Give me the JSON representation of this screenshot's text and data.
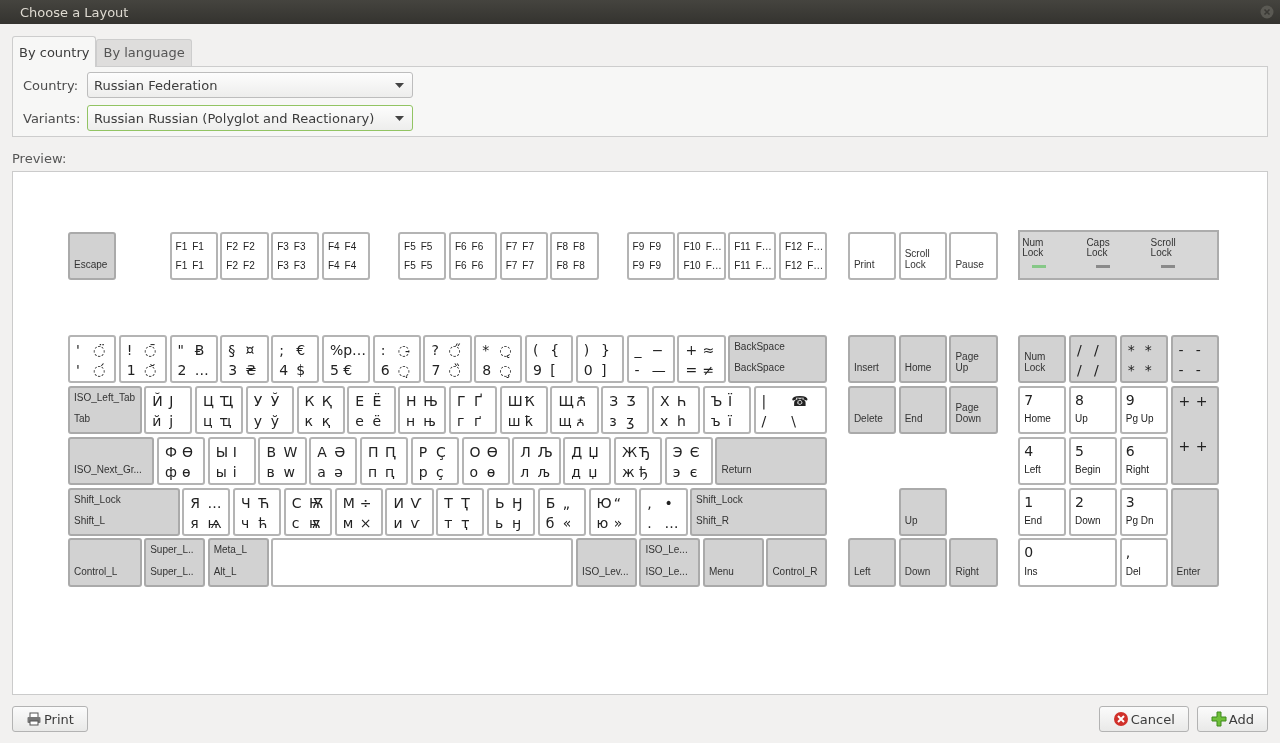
{
  "window": {
    "title": "Choose a Layout"
  },
  "tabs": [
    {
      "label": "By country",
      "selected": true
    },
    {
      "label": "By language",
      "selected": false
    }
  ],
  "form": [
    {
      "label": "Country:",
      "value": "Russian Federation",
      "focused": false
    },
    {
      "label": "Variants:",
      "value": "Russian Russian (Polyglot and Reactionary)",
      "focused": true
    }
  ],
  "preview": {
    "label": "Preview:",
    "keyboard": {
      "function_row": [
        [
          {
            "kind": "mod",
            "legends": [
              "Escape"
            ]
          }
        ],
        [
          {
            "kind": "fn",
            "legends": [
              "F1",
              "F1",
              "F1",
              "F1"
            ]
          },
          {
            "kind": "fn",
            "legends": [
              "F2",
              "F2",
              "F2",
              "F2"
            ]
          },
          {
            "kind": "fn",
            "legends": [
              "F3",
              "F3",
              "F3",
              "F3"
            ]
          },
          {
            "kind": "fn",
            "legends": [
              "F4",
              "F4",
              "F4",
              "F4"
            ]
          }
        ],
        [
          {
            "kind": "fn",
            "legends": [
              "F5",
              "F5",
              "F5",
              "F5"
            ]
          },
          {
            "kind": "fn",
            "legends": [
              "F6",
              "F6",
              "F6",
              "F6"
            ]
          },
          {
            "kind": "fn",
            "legends": [
              "F7",
              "F7",
              "F7",
              "F7"
            ]
          },
          {
            "kind": "fn",
            "legends": [
              "F8",
              "F8",
              "F8",
              "F8"
            ]
          }
        ],
        [
          {
            "kind": "fn",
            "legends": [
              "F9",
              "F9",
              "F9",
              "F9"
            ]
          },
          {
            "kind": "fn",
            "legends": [
              "F10",
              "F…",
              "F10",
              "F…"
            ]
          },
          {
            "kind": "fn",
            "legends": [
              "F11",
              "F…",
              "F11",
              "F…"
            ]
          },
          {
            "kind": "fn",
            "legends": [
              "F12",
              "F…",
              "F12",
              "F…"
            ]
          }
        ]
      ],
      "system_keys": [
        {
          "kind": "sys",
          "legends": [
            "Print"
          ]
        },
        {
          "kind": "sys",
          "legends": [
            "Scroll Lock"
          ]
        },
        {
          "kind": "sys",
          "legends": [
            "Pause"
          ]
        }
      ],
      "indicators": [
        {
          "label": "Num Lock",
          "on": true
        },
        {
          "label": "Caps Lock",
          "on": false
        },
        {
          "label": "Scroll Lock",
          "on": false
        }
      ],
      "main_rows": [
        [
          {
            "kind": "char",
            "legends": [
              "'",
              "◌̈",
              "'",
              "◌́"
            ]
          },
          {
            "kind": "char",
            "legends": [
              "!",
              "◌̄",
              "1",
              "◌̆"
            ]
          },
          {
            "kind": "char",
            "legends": [
              "\"",
              "Ƀ",
              "2",
              "…"
            ]
          },
          {
            "kind": "char",
            "legends": [
              "§",
              "¤",
              "3",
              "₴"
            ]
          },
          {
            "kind": "char",
            "legends": [
              ";",
              "€",
              "4",
              "$"
            ]
          },
          {
            "kind": "char",
            "legends": [
              "%",
              "р…",
              "5",
              "€"
            ]
          },
          {
            "kind": "char",
            "legends": [
              ":",
              "◌̵",
              "6",
              "◌̣"
            ]
          },
          {
            "kind": "char",
            "legends": [
              "?",
              "◌̋",
              "7",
              "◌̏"
            ]
          },
          {
            "kind": "char",
            "legends": [
              "*",
              "◌̨",
              "8",
              "◌̧"
            ]
          },
          {
            "kind": "char",
            "legends": [
              "(",
              "{",
              "9",
              "["
            ]
          },
          {
            "kind": "char",
            "legends": [
              ")",
              "}",
              "0",
              "]"
            ]
          },
          {
            "kind": "char",
            "legends": [
              "_",
              "−",
              "-",
              "—"
            ]
          },
          {
            "kind": "char",
            "legends": [
              "+",
              "≈",
              "=",
              "≠"
            ]
          },
          {
            "kind": "mod",
            "legends": [
              "BackSpace",
              "BackSpace"
            ]
          }
        ],
        [
          {
            "kind": "mod",
            "legends": [
              "ISO_Left_Tab",
              "Tab"
            ]
          },
          {
            "kind": "char",
            "legends": [
              "Й",
              "Ј",
              "й",
              "ј"
            ]
          },
          {
            "kind": "char",
            "legends": [
              "Ц",
              "Ҵ",
              "ц",
              "ҵ"
            ]
          },
          {
            "kind": "char",
            "legends": [
              "У",
              "Ў",
              "у",
              "ў"
            ]
          },
          {
            "kind": "char",
            "legends": [
              "К",
              "Қ",
              "к",
              "қ"
            ]
          },
          {
            "kind": "char",
            "legends": [
              "Е",
              "Ё",
              "е",
              "ё"
            ]
          },
          {
            "kind": "char",
            "legends": [
              "Н",
              "Њ",
              "н",
              "њ"
            ]
          },
          {
            "kind": "char",
            "legends": [
              "Г",
              "Ґ",
              "г",
              "ґ"
            ]
          },
          {
            "kind": "char",
            "legends": [
              "Ш",
              "Ҟ",
              "ш",
              "ҟ"
            ]
          },
          {
            "kind": "char",
            "legends": [
              "Щ",
              "Ꙉ",
              "щ",
              "ꙉ"
            ]
          },
          {
            "kind": "char",
            "legends": [
              "З",
              "Ʒ",
              "з",
              "ʒ"
            ]
          },
          {
            "kind": "char",
            "legends": [
              "Х",
              "Һ",
              "х",
              "һ"
            ]
          },
          {
            "kind": "char",
            "legends": [
              "Ъ",
              "Ї",
              "ъ",
              "ї"
            ]
          },
          {
            "kind": "char",
            "legends": [
              "|",
              "☎",
              "/",
              "\\"
            ]
          }
        ],
        [
          {
            "kind": "mod",
            "legends": [
              "ISO_Next_Gr..."
            ]
          },
          {
            "kind": "char",
            "legends": [
              "Ф",
              "Ѳ",
              "ф",
              "ѳ"
            ]
          },
          {
            "kind": "char",
            "legends": [
              "Ы",
              "І",
              "ы",
              "і"
            ]
          },
          {
            "kind": "char",
            "legends": [
              "В",
              "W",
              "в",
              "w"
            ]
          },
          {
            "kind": "char",
            "legends": [
              "А",
              "Ә",
              "а",
              "ә"
            ]
          },
          {
            "kind": "char",
            "legends": [
              "П",
              "Ԥ",
              "п",
              "ԥ"
            ]
          },
          {
            "kind": "char",
            "legends": [
              "Р",
              "Ҫ",
              "р",
              "ҫ"
            ]
          },
          {
            "kind": "char",
            "legends": [
              "О",
              "Ө",
              "о",
              "ө"
            ]
          },
          {
            "kind": "char",
            "legends": [
              "Л",
              "Љ",
              "л",
              "љ"
            ]
          },
          {
            "kind": "char",
            "legends": [
              "Д",
              "Џ",
              "д",
              "џ"
            ]
          },
          {
            "kind": "char",
            "legends": [
              "Ж",
              "Ђ",
              "ж",
              "ђ"
            ]
          },
          {
            "kind": "char",
            "legends": [
              "Э",
              "Є",
              "э",
              "є"
            ]
          },
          {
            "kind": "mod",
            "legends": [
              "Return"
            ]
          }
        ],
        [
          {
            "kind": "mod",
            "legends": [
              "Shift_Lock",
              "Shift_L"
            ]
          },
          {
            "kind": "char",
            "legends": [
              "Я",
              "…",
              "я",
              "ѩ"
            ]
          },
          {
            "kind": "char",
            "legends": [
              "Ч",
              "Ћ",
              "ч",
              "ћ"
            ]
          },
          {
            "kind": "char",
            "legends": [
              "С",
              "Ѭ",
              "с",
              "ѭ"
            ]
          },
          {
            "kind": "char",
            "legends": [
              "М",
              "÷",
              "м",
              "×"
            ]
          },
          {
            "kind": "char",
            "legends": [
              "И",
              "Ѵ",
              "и",
              "ѵ"
            ]
          },
          {
            "kind": "char",
            "legends": [
              "Т",
              "Ҭ",
              "т",
              "ҭ"
            ]
          },
          {
            "kind": "char",
            "legends": [
              "Ь",
              "Ӈ",
              "ь",
              "ӈ"
            ]
          },
          {
            "kind": "char",
            "legends": [
              "Б",
              "„",
              "б",
              "«"
            ]
          },
          {
            "kind": "char",
            "legends": [
              "Ю",
              "“",
              "ю",
              "»"
            ]
          },
          {
            "kind": "char",
            "legends": [
              ",",
              "•",
              ".",
              "…"
            ]
          },
          {
            "kind": "mod",
            "legends": [
              "Shift_Lock",
              "Shift_R"
            ]
          }
        ],
        [
          {
            "kind": "mod",
            "legends": [
              "Control_L"
            ]
          },
          {
            "kind": "mod",
            "legends": [
              "Super_L..",
              "Super_L.."
            ]
          },
          {
            "kind": "mod",
            "legends": [
              "Meta_L",
              "Alt_L"
            ]
          },
          {
            "kind": "space"
          },
          {
            "kind": "mod",
            "legends": [
              "ISO_Lev..."
            ]
          },
          {
            "kind": "mod",
            "legends": [
              "ISO_Le...",
              "ISO_Le..."
            ]
          },
          {
            "kind": "mod",
            "legends": [
              "Menu"
            ]
          },
          {
            "kind": "mod",
            "legends": [
              "Control_R"
            ]
          }
        ]
      ],
      "navigation": [
        {
          "kind": "mod",
          "legends": [
            "Insert"
          ]
        },
        {
          "kind": "mod",
          "legends": [
            "Home"
          ]
        },
        {
          "kind": "mod",
          "legends": [
            "Page Up"
          ]
        },
        {
          "kind": "mod",
          "legends": [
            "Delete"
          ]
        },
        {
          "kind": "mod",
          "legends": [
            "End"
          ]
        },
        {
          "kind": "mod",
          "legends": [
            "Page Down"
          ]
        },
        {
          "kind": "mod",
          "legends": [
            "Up"
          ]
        },
        {
          "kind": "mod",
          "legends": [
            "Left"
          ]
        },
        {
          "kind": "mod",
          "legends": [
            "Down"
          ]
        },
        {
          "kind": "mod",
          "legends": [
            "Right"
          ]
        }
      ],
      "numpad": [
        {
          "kind": "mod",
          "legends": [
            "Num Lock"
          ]
        },
        {
          "kind": "op",
          "legends": [
            "/",
            "/",
            "/",
            "/"
          ]
        },
        {
          "kind": "op",
          "legends": [
            "*",
            "*",
            "*",
            "*"
          ]
        },
        {
          "kind": "op",
          "legends": [
            "-",
            "-",
            "-",
            "-"
          ]
        },
        {
          "kind": "keypad",
          "legends": [
            "7",
            "Home"
          ]
        },
        {
          "kind": "keypad",
          "legends": [
            "8",
            "Up"
          ]
        },
        {
          "kind": "keypad",
          "legends": [
            "9",
            "Pg Up"
          ]
        },
        {
          "kind": "op",
          "legends": [
            "+",
            "+",
            "+",
            "+"
          ]
        },
        {
          "kind": "keypad",
          "legends": [
            "4",
            "Left"
          ]
        },
        {
          "kind": "keypad",
          "legends": [
            "5",
            "Begin"
          ]
        },
        {
          "kind": "keypad",
          "legends": [
            "6",
            "Right"
          ]
        },
        {
          "kind": "keypad",
          "legends": [
            "1",
            "End"
          ]
        },
        {
          "kind": "keypad",
          "legends": [
            "2",
            "Down"
          ]
        },
        {
          "kind": "keypad",
          "legends": [
            "3",
            "Pg Dn"
          ]
        },
        {
          "kind": "keypad",
          "legends": [
            "0",
            "Ins"
          ]
        },
        {
          "kind": "keypad",
          "legends": [
            ",",
            "Del"
          ]
        },
        {
          "kind": "mod",
          "legends": [
            "Enter"
          ]
        }
      ]
    }
  },
  "actions": {
    "left": [
      {
        "kind": "print",
        "label": "Print"
      }
    ],
    "right": [
      {
        "kind": "cancel",
        "label": "Cancel"
      },
      {
        "kind": "add",
        "label": "Add"
      }
    ]
  }
}
